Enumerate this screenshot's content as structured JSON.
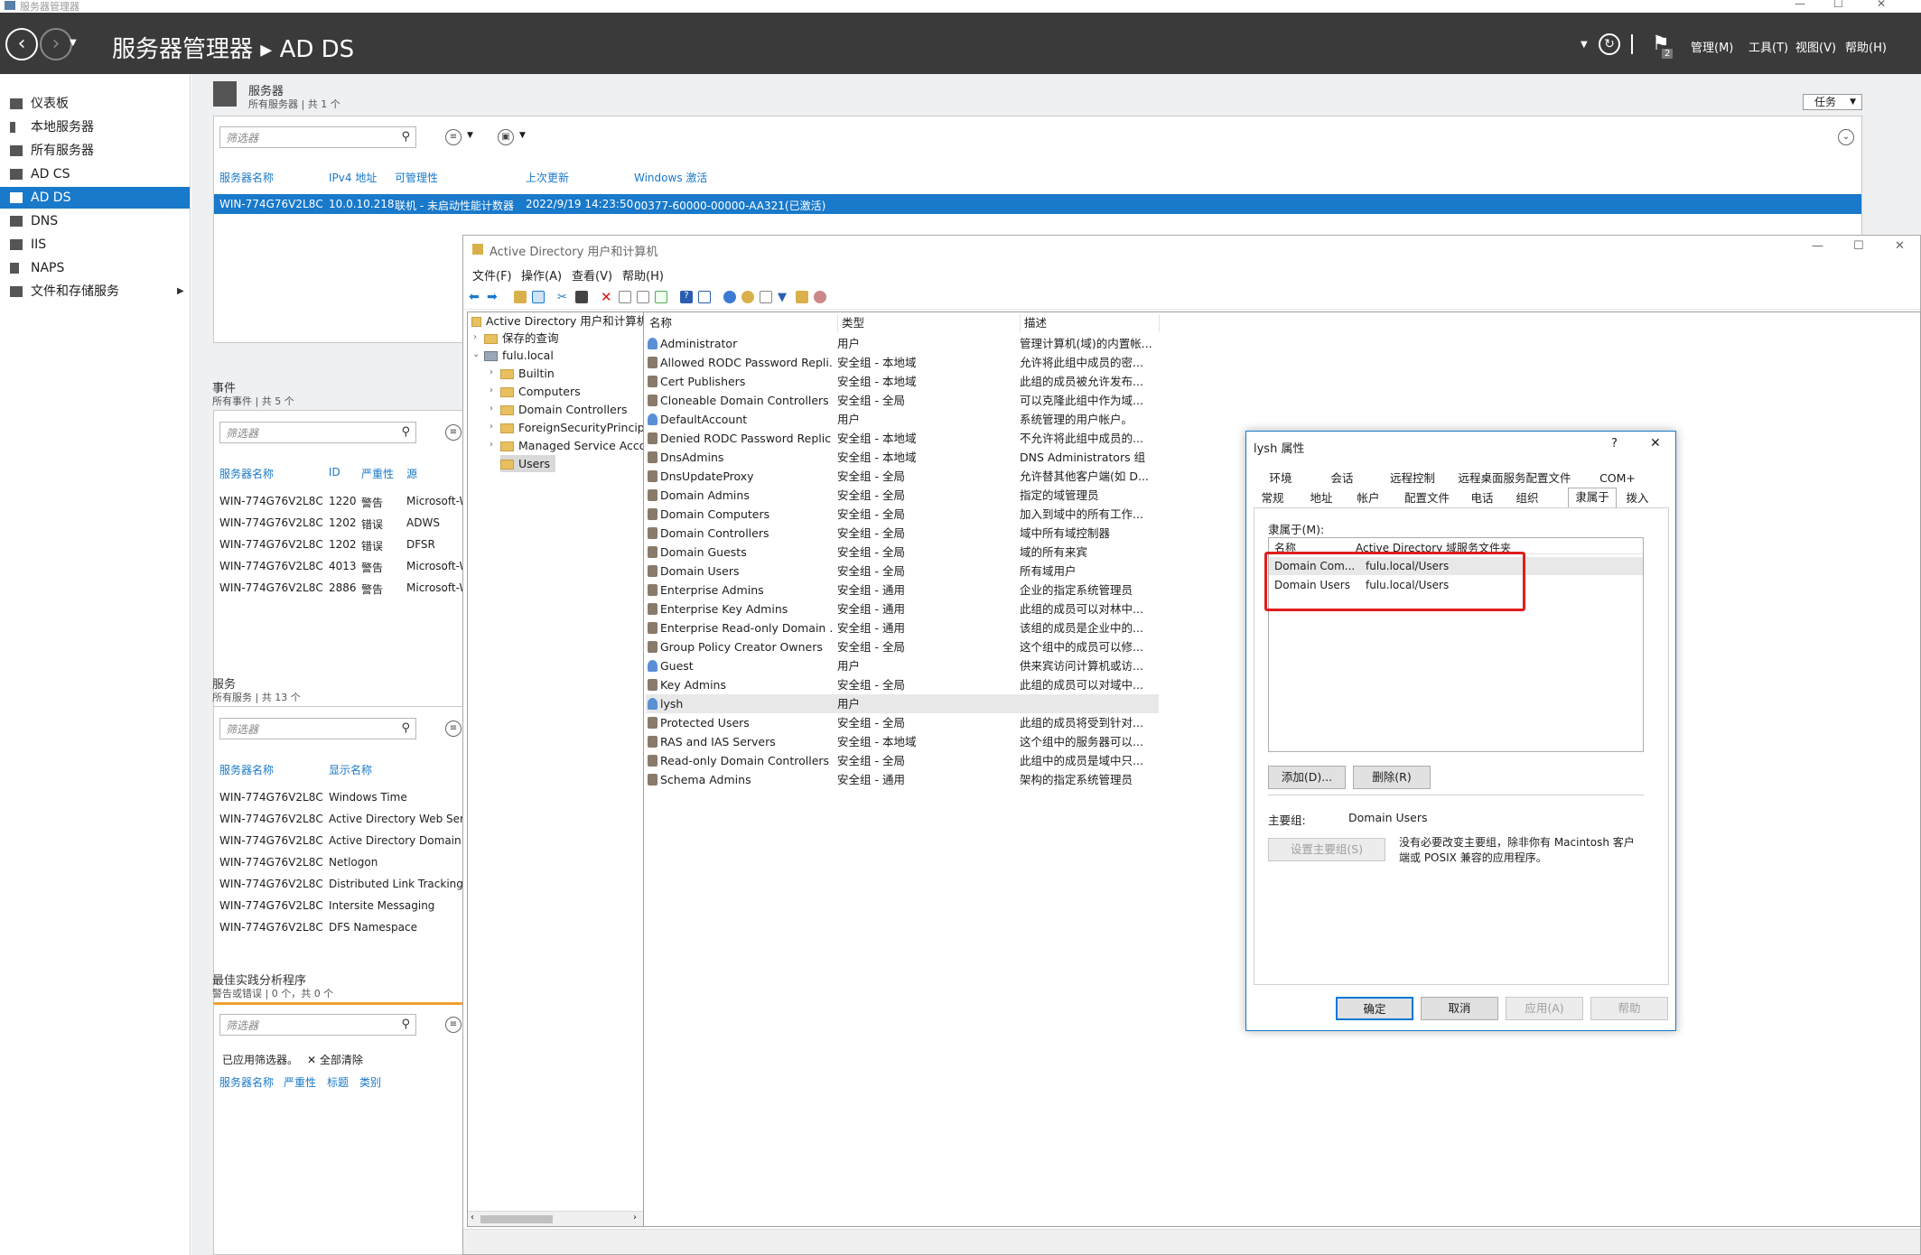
{
  "app": {
    "window_title": "服务器管理器"
  },
  "header": {
    "title": "服务器管理器 ▸ AD DS",
    "flag_count": "2",
    "menus": [
      "管理(M)",
      "工具(T)",
      "视图(V)",
      "帮助(H)"
    ]
  },
  "sidebar": {
    "items": [
      {
        "label": "仪表板",
        "icon": "dashboard-icon"
      },
      {
        "label": "本地服务器",
        "icon": "server-icon"
      },
      {
        "label": "所有服务器",
        "icon": "servers-icon"
      },
      {
        "label": "AD CS",
        "icon": "adcs-icon"
      },
      {
        "label": "AD DS",
        "icon": "adds-icon"
      },
      {
        "label": "DNS",
        "icon": "dns-icon"
      },
      {
        "label": "IIS",
        "icon": "iis-icon"
      },
      {
        "label": "NAPS",
        "icon": "naps-icon"
      },
      {
        "label": "文件和存储服务",
        "icon": "storage-icon"
      }
    ]
  },
  "servers": {
    "title": "服务器",
    "subtitle": "所有服务器 | 共 1 个",
    "tasks": "任务",
    "filter_placeholder": "筛选器",
    "columns": [
      "服务器名称",
      "IPv4 地址",
      "可管理性",
      "上次更新",
      "Windows 激活"
    ],
    "row": [
      "WIN-774G76V2L8C",
      "10.0.10.218",
      "联机 - 未启动性能计数器",
      "2022/9/19 14:23:50",
      "00377-60000-00000-AA321(已激活)"
    ]
  },
  "events": {
    "title": "事件",
    "subtitle": "所有事件 | 共 5 个",
    "filter_placeholder": "筛选器",
    "columns": [
      "服务器名称",
      "ID",
      "严重性",
      "源"
    ],
    "rows": [
      [
        "WIN-774G76V2L8C",
        "1220",
        "警告",
        "Microsoft-W"
      ],
      [
        "WIN-774G76V2L8C",
        "1202",
        "错误",
        "ADWS"
      ],
      [
        "WIN-774G76V2L8C",
        "1202",
        "错误",
        "DFSR"
      ],
      [
        "WIN-774G76V2L8C",
        "4013",
        "警告",
        "Microsoft-W"
      ],
      [
        "WIN-774G76V2L8C",
        "2886",
        "警告",
        "Microsoft-W"
      ]
    ]
  },
  "services": {
    "title": "服务",
    "subtitle": "所有服务 | 共 13 个",
    "filter_placeholder": "筛选器",
    "columns": [
      "服务器名称",
      "显示名称"
    ],
    "rows": [
      [
        "WIN-774G76V2L8C",
        "Windows Time"
      ],
      [
        "WIN-774G76V2L8C",
        "Active Directory Web Serv"
      ],
      [
        "WIN-774G76V2L8C",
        "Active Directory Domain S"
      ],
      [
        "WIN-774G76V2L8C",
        "Netlogon"
      ],
      [
        "WIN-774G76V2L8C",
        "Distributed Link Tracking C"
      ],
      [
        "WIN-774G76V2L8C",
        "Intersite Messaging"
      ],
      [
        "WIN-774G76V2L8C",
        "DFS Namespace"
      ]
    ]
  },
  "bpa": {
    "title": "最佳实践分析程序",
    "subtitle": "警告或错误 | 0 个，共 0 个",
    "filter_placeholder": "筛选器",
    "filter_applied": "已应用筛选器。",
    "clear_all": "全部清除",
    "columns": [
      "服务器名称",
      "严重性",
      "标题",
      "类别"
    ]
  },
  "aduc": {
    "title": "Active Directory 用户和计算机",
    "menu": [
      "文件(F)",
      "操作(A)",
      "查看(V)",
      "帮助(H)"
    ],
    "tree": {
      "root": "Active Directory 用户和计算机",
      "saved": "保存的查询",
      "domain": "fulu.local",
      "children": [
        "Builtin",
        "Computers",
        "Domain Controllers",
        "ForeignSecurityPrincipals",
        "Managed Service Accounts",
        "Users"
      ]
    },
    "columns": [
      "名称",
      "类型",
      "描述"
    ],
    "rows": [
      [
        "Administrator",
        "用户",
        "管理计算机(域)的内置帐..."
      ],
      [
        "Allowed RODC Password Repli...",
        "安全组 - 本地域",
        "允许将此组中成员的密..."
      ],
      [
        "Cert Publishers",
        "安全组 - 本地域",
        "此组的成员被允许发布..."
      ],
      [
        "Cloneable Domain Controllers",
        "安全组 - 全局",
        "可以克隆此组中作为域..."
      ],
      [
        "DefaultAccount",
        "用户",
        "系统管理的用户帐户。"
      ],
      [
        "Denied RODC Password Replic...",
        "安全组 - 本地域",
        "不允许将此组中成员的..."
      ],
      [
        "DnsAdmins",
        "安全组 - 本地域",
        "DNS Administrators 组"
      ],
      [
        "DnsUpdateProxy",
        "安全组 - 全局",
        "允许替其他客户端(如 D..."
      ],
      [
        "Domain Admins",
        "安全组 - 全局",
        "指定的域管理员"
      ],
      [
        "Domain Computers",
        "安全组 - 全局",
        "加入到域中的所有工作..."
      ],
      [
        "Domain Controllers",
        "安全组 - 全局",
        "域中所有域控制器"
      ],
      [
        "Domain Guests",
        "安全组 - 全局",
        "域的所有来宾"
      ],
      [
        "Domain Users",
        "安全组 - 全局",
        "所有域用户"
      ],
      [
        "Enterprise Admins",
        "安全组 - 通用",
        "企业的指定系统管理员"
      ],
      [
        "Enterprise Key Admins",
        "安全组 - 通用",
        "此组的成员可以对林中..."
      ],
      [
        "Enterprise Read-only Domain ...",
        "安全组 - 通用",
        "该组的成员是企业中的..."
      ],
      [
        "Group Policy Creator Owners",
        "安全组 - 全局",
        "这个组中的成员可以修..."
      ],
      [
        "Guest",
        "用户",
        "供来宾访问计算机或访..."
      ],
      [
        "Key Admins",
        "安全组 - 全局",
        "此组的成员可以对域中..."
      ],
      [
        "lysh",
        "用户",
        ""
      ],
      [
        "Protected Users",
        "安全组 - 全局",
        "此组的成员将受到针对..."
      ],
      [
        "RAS and IAS Servers",
        "安全组 - 本地域",
        "这个组中的服务器可以..."
      ],
      [
        "Read-only Domain Controllers",
        "安全组 - 全局",
        "此组中的成员是域中只..."
      ],
      [
        "Schema Admins",
        "安全组 - 通用",
        "架构的指定系统管理员"
      ]
    ]
  },
  "dialog": {
    "title": "lysh 属性",
    "help": "?",
    "close": "✕",
    "tabs_row1": [
      "环境",
      "会话",
      "远程控制",
      "远程桌面服务配置文件",
      "COM+"
    ],
    "tabs_row2": [
      "常规",
      "地址",
      "帐户",
      "配置文件",
      "电话",
      "组织",
      "隶属于",
      "拨入"
    ],
    "member_of_label": "隶属于(M):",
    "columns": [
      "名称",
      "Active Directory 域服务文件夹"
    ],
    "rows": [
      [
        "Domain Com...",
        "fulu.local/Users"
      ],
      [
        "Domain Users",
        "fulu.local/Users"
      ]
    ],
    "add": "添加(D)...",
    "remove": "删除(R)",
    "primary_group_label": "主要组:",
    "primary_group_value": "Domain Users",
    "set_primary": "设置主要组(S)",
    "note": "没有必要改变主要组，除非你有 Macintosh 客户端或 POSIX 兼容的应用程序。",
    "ok": "确定",
    "cancel": "取消",
    "apply": "应用(A)",
    "help_btn": "帮助"
  },
  "colors": {
    "accent": "#1979ca",
    "header_bg": "#3a3a3a",
    "highlight": "#e11d1d"
  }
}
